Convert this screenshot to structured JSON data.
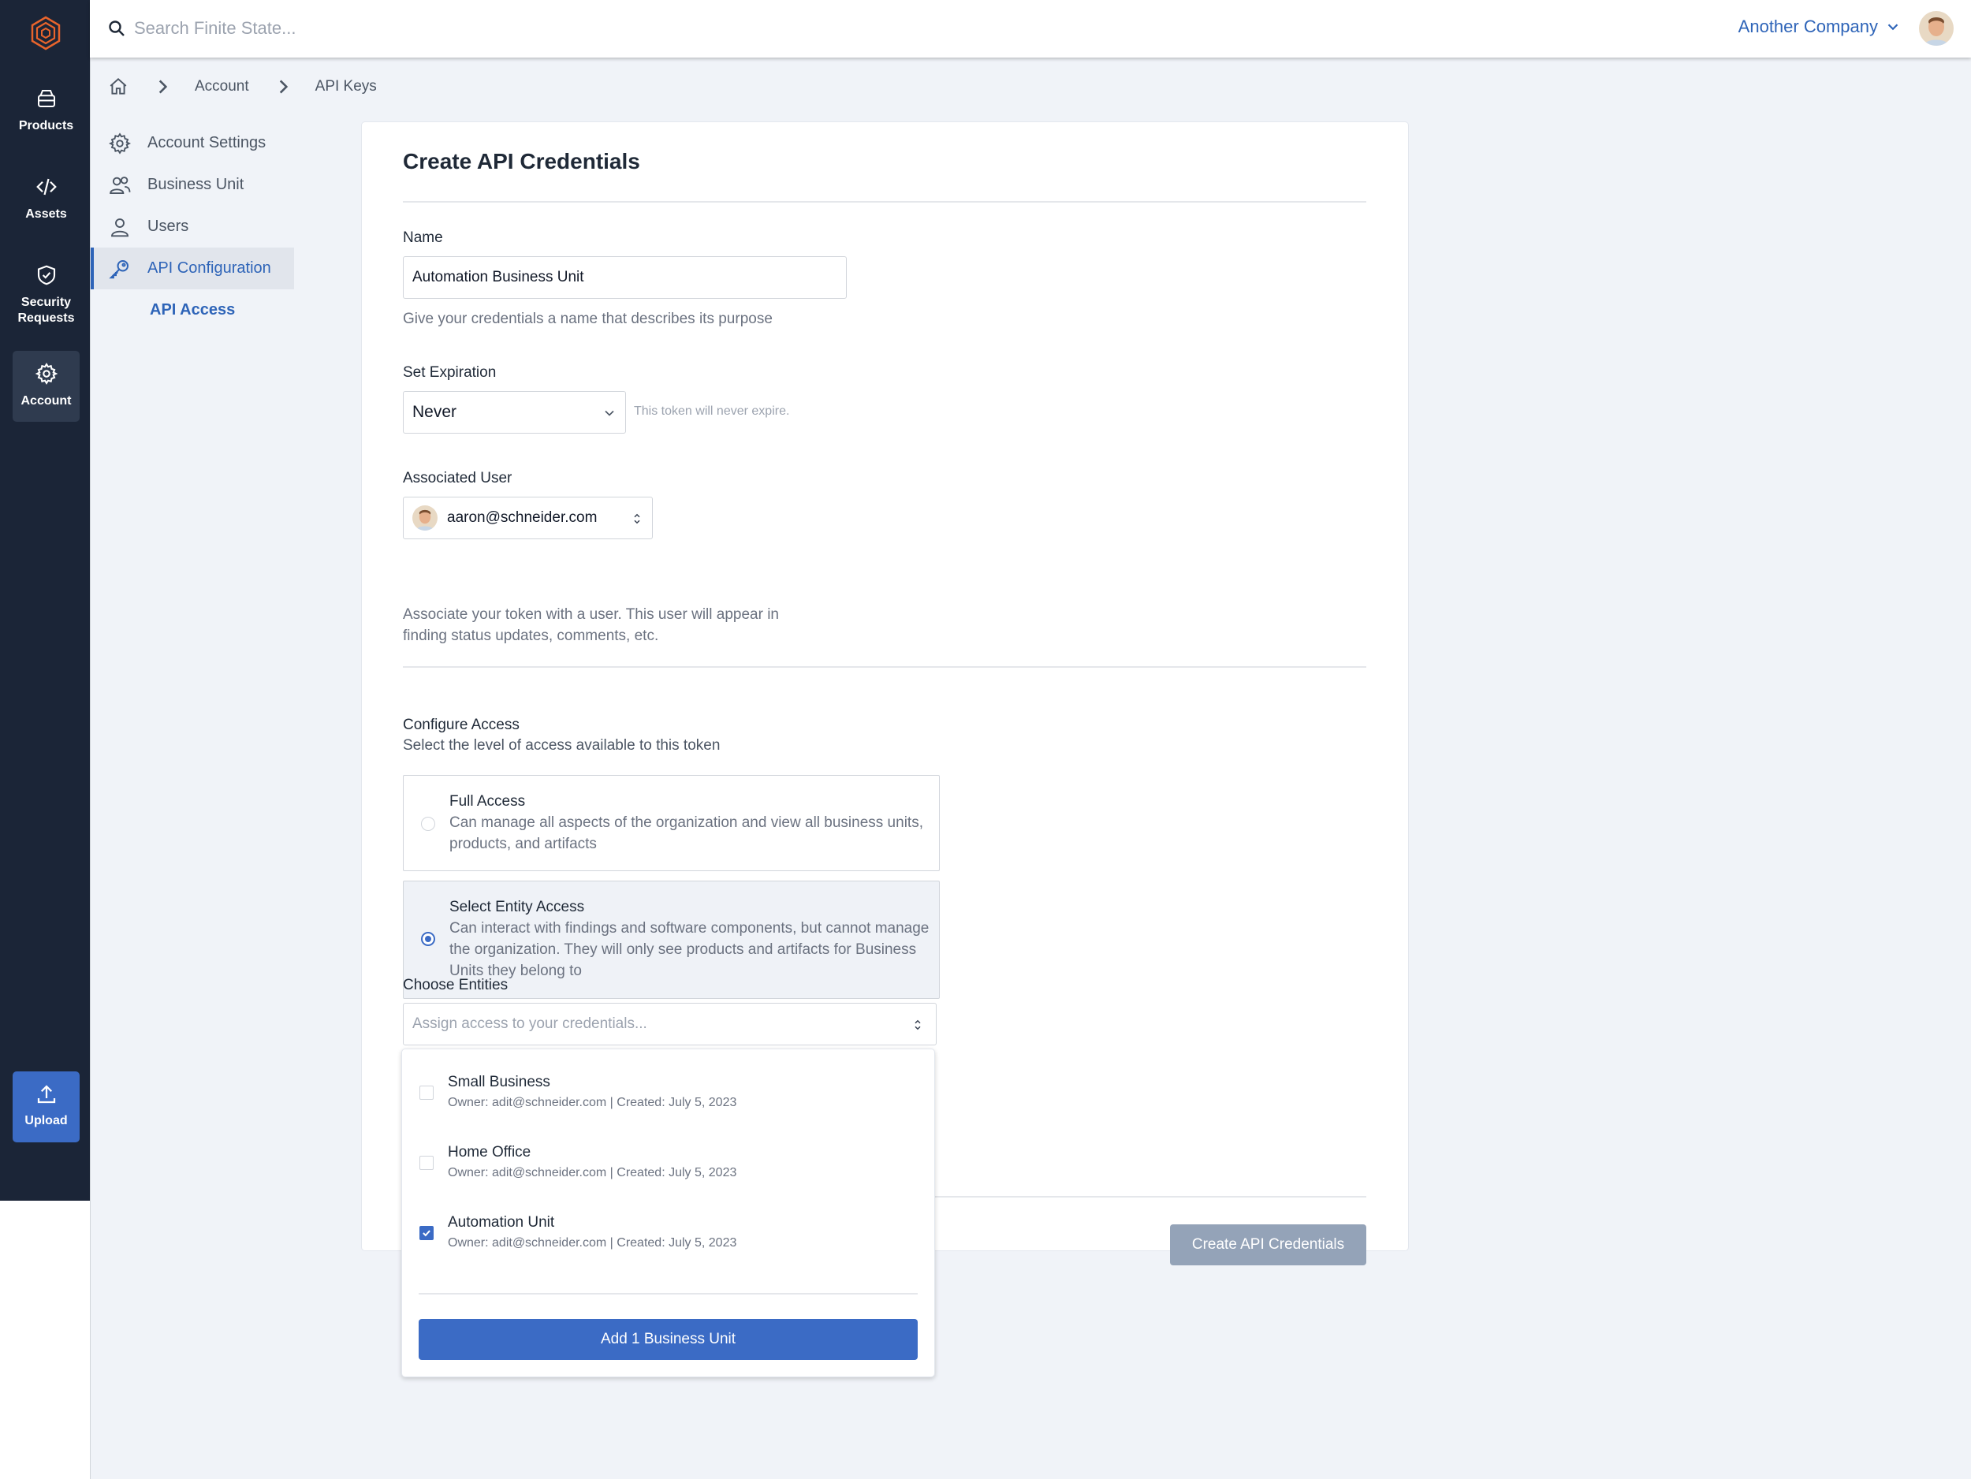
{
  "nav": {
    "items": [
      {
        "label": "Products",
        "icon": "package-icon"
      },
      {
        "label": "Assets",
        "icon": "code-icon"
      },
      {
        "label": "Security Requests",
        "icon": "shield-check-icon"
      },
      {
        "label": "Account",
        "icon": "gear-icon",
        "active": true
      }
    ],
    "upload_label": "Upload"
  },
  "topbar": {
    "search_placeholder": "Search Finite State...",
    "company": "Another Company"
  },
  "breadcrumb": [
    "Account",
    "API Keys"
  ],
  "subnav": {
    "items": [
      {
        "label": "Account Settings",
        "icon": "gear-icon"
      },
      {
        "label": "Business Unit",
        "icon": "users-icon"
      },
      {
        "label": "Users",
        "icon": "user-icon"
      },
      {
        "label": "API Configuration",
        "icon": "key-icon",
        "active": true
      }
    ],
    "child": "API Access"
  },
  "form": {
    "title": "Create API Credentials",
    "name_label": "Name",
    "name_value": "Automation Business Unit",
    "name_help": "Give your credentials a name that describes its purpose",
    "expiration_label": "Set Expiration",
    "expiration_value": "Never",
    "expiration_note": "This token will never expire.",
    "user_label": "Associated User",
    "user_value": "aaron@schneider.com",
    "user_help_1": "Associate your token with a user. This user will appear in",
    "user_help_2": "finding status updates, comments, etc.",
    "access_label": "Configure Access",
    "access_help": "Select the level of access available to this token",
    "access_options": [
      {
        "title": "Full Access",
        "desc": "Can manage all aspects of the organization and view all business units, products, and artifacts",
        "selected": false
      },
      {
        "title": "Select Entity Access",
        "desc": "Can interact with findings and software components, but cannot manage the organization. They will only see products and artifacts for Business Units they belong to",
        "selected": true
      }
    ],
    "entities_label": "Choose Entities",
    "entities_placeholder": "Assign access to your credentials...",
    "submit_label": "Create API Credentials"
  },
  "dropdown": {
    "items": [
      {
        "title": "Small Business",
        "meta": "Owner: adit@schneider.com | Created: July 5, 2023",
        "checked": false
      },
      {
        "title": "Home Office",
        "meta": "Owner: adit@schneider.com | Created: July 5, 2023",
        "checked": false
      },
      {
        "title": "Automation Unit",
        "meta": "Owner: adit@schneider.com | Created: July 5, 2023",
        "checked": true
      }
    ],
    "add_label": "Add 1 Business Unit"
  },
  "colors": {
    "rail": "#1b2537",
    "accent": "#3b6bc5",
    "link": "#2e64b8",
    "disabled_button": "#94a3b8"
  }
}
